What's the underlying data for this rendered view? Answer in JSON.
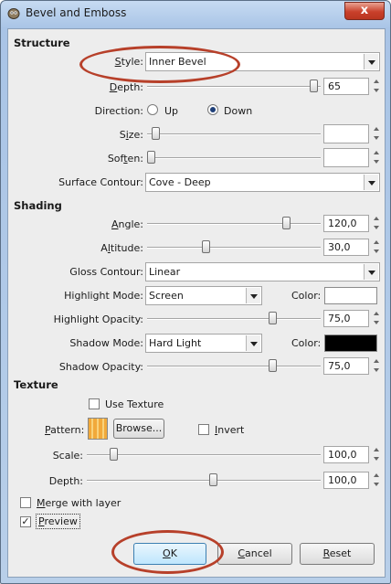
{
  "window": {
    "title": "Bevel and Emboss",
    "close_label": "x"
  },
  "structure": {
    "heading": "Structure",
    "style_label": "Style:",
    "style_value": "Inner Bevel",
    "depth_label": "Depth:",
    "depth_value": "65",
    "depth_level": 0.65,
    "direction_label": "Direction:",
    "direction_up": "Up",
    "direction_down": "Down",
    "direction_selected": "Down",
    "size_label": "Size:",
    "size_value": "",
    "soften_label": "Soften:",
    "soften_value": "",
    "surface_contour_label": "Surface Contour:",
    "surface_contour_value": "Cove - Deep"
  },
  "shading": {
    "heading": "Shading",
    "angle_label": "Angle:",
    "angle_value": "120,0",
    "altitude_label": "Altitude:",
    "altitude_value": "30,0",
    "gloss_contour_label": "Gloss Contour:",
    "gloss_contour_value": "Linear",
    "highlight_mode_label": "Highlight Mode:",
    "highlight_mode_value": "Screen",
    "highlight_color_label": "Color:",
    "highlight_color": "#ffffff",
    "highlight_opacity_label": "Highlight Opacity:",
    "highlight_opacity_value": "75,0",
    "shadow_mode_label": "Shadow Mode:",
    "shadow_mode_value": "Hard Light",
    "shadow_color_label": "Color:",
    "shadow_color": "#000000",
    "shadow_opacity_label": "Shadow Opacity:",
    "shadow_opacity_value": "75,0"
  },
  "texture": {
    "heading": "Texture",
    "use_texture_label": "Use Texture",
    "use_texture_checked": false,
    "pattern_label": "Pattern:",
    "browse_label": "Browse...",
    "invert_label": "Invert",
    "scale_label": "Scale:",
    "scale_value": "100,0",
    "depth_label": "Depth:",
    "depth_value": "100,0"
  },
  "options": {
    "merge_label": "Merge with layer",
    "merge_checked": false,
    "preview_label": "Preview",
    "preview_checked": true
  },
  "buttons": {
    "ok": "OK",
    "cancel": "Cancel",
    "reset": "Reset"
  },
  "annotation_color": "#b7402a"
}
